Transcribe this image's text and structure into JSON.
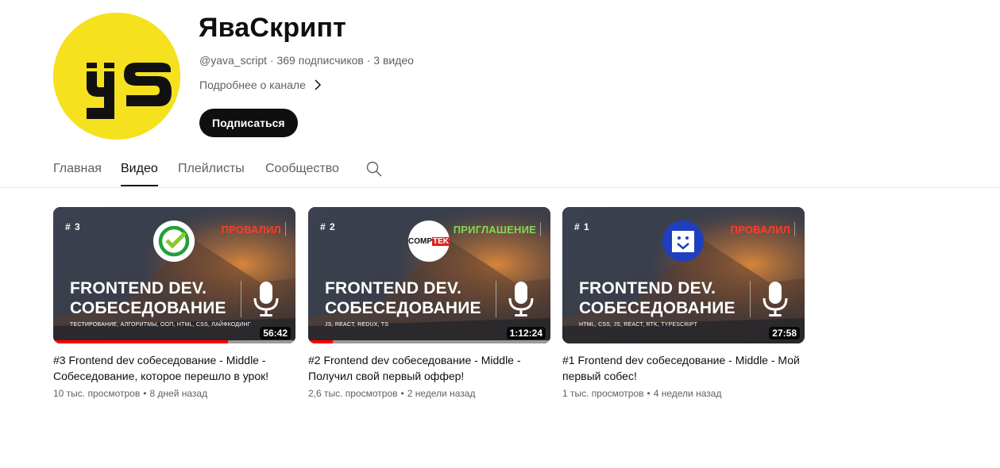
{
  "channel": {
    "name": "ЯваСкрипт",
    "handle": "@yava_script",
    "subscribers": "369 подписчиков",
    "videos_count": "3 видео",
    "meta_sep": "·",
    "more_label": "Подробнее о канале",
    "subscribe_label": "Подписаться",
    "avatar_text": "ys",
    "avatar_color": "#f5e11d"
  },
  "tabs": [
    {
      "label": "Главная",
      "active": false
    },
    {
      "label": "Видео",
      "active": true
    },
    {
      "label": "Плейлисты",
      "active": false
    },
    {
      "label": "Сообщество",
      "active": false
    }
  ],
  "videos": [
    {
      "episode": "# 3",
      "status": "ПРОВАЛИЛ",
      "status_color": "#ff3b30",
      "headline_1": "FRONTEND DEV.",
      "headline_2": "СОБЕСЕДОВАНИЕ",
      "tags": "ТЕСТИРОВАНИЕ, АЛГОРИТМЫ, ООП, HTML, CSS, ЛАЙФКОДИНГ",
      "company_logo": "sber-icon",
      "duration": "56:42",
      "watched_fraction": 0.72,
      "title": "#3 Frontend dev собеседование - Middle - Собеседование, которое перешло в урок!",
      "views": "10 тыс. просмотров",
      "age": "8 дней назад"
    },
    {
      "episode": "# 2",
      "status": "ПРИГЛАШЕНИЕ",
      "status_color": "#7ed957",
      "headline_1": "FRONTEND DEV.",
      "headline_2": "СОБЕСЕДОВАНИЕ",
      "tags": "JS, REACT, REDUX, TS",
      "company_logo": "comptek-logo",
      "company_text_1": "COMP",
      "company_text_2": "TEK",
      "duration": "1:12:24",
      "watched_fraction": 0.1,
      "title": "#2 Frontend dev собеседование - Middle - Получил свой первый оффер!",
      "views": "2,6 тыс. просмотров",
      "age": "2 недели назад"
    },
    {
      "episode": "# 1",
      "status": "ПРОВАЛИЛ",
      "status_color": "#ff3b30",
      "headline_1": "FRONTEND DEV.",
      "headline_2": "СОБЕСЕДОВАНИЕ",
      "tags": "HTML, CSS, JS, REACT, RTK, TYPESCRIPT",
      "company_logo": "chat-check-icon",
      "duration": "27:58",
      "watched_fraction": 0,
      "title": "#1 Frontend dev собеседование - Middle - Мой первый собес!",
      "views": "1 тыс. просмотров",
      "age": "4 недели назад"
    }
  ],
  "meta_dot": "•"
}
